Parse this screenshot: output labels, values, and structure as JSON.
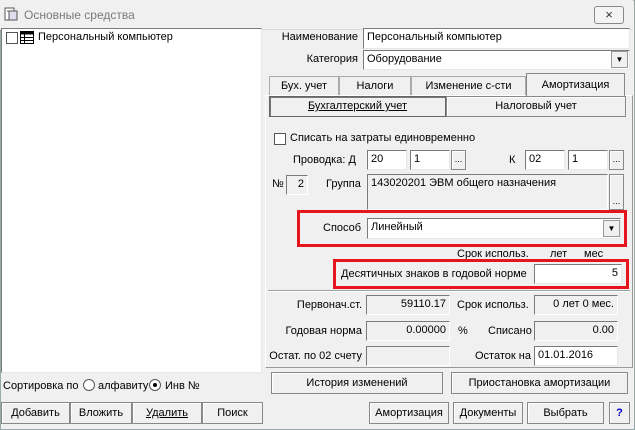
{
  "window": {
    "title": "Основные средства",
    "close_icon": "×"
  },
  "tree": {
    "items": [
      {
        "label": "Персональный компьютер"
      }
    ]
  },
  "sort": {
    "label": "Сортировка по",
    "option1": "алфавиту",
    "option2": "Инв №",
    "selected": "Инв №"
  },
  "left_buttons": {
    "add": "Добавить",
    "insert": "Вложить",
    "delete": "Удалить",
    "search": "Поиск"
  },
  "form": {
    "name_label": "Наименование",
    "name_value": "Персональный компьютер",
    "category_label": "Категория",
    "category_value": "Оборудование"
  },
  "tabs": [
    "Бух. учет",
    "Налоги",
    "Изменение с-сти",
    "Амортизация"
  ],
  "active_tab": "Амортизация",
  "subtabs": [
    "Бухгалтерский учет",
    "Налоговый учет"
  ],
  "amort": {
    "writeoff_label": "Списать на затраты единовременно",
    "posting_label": "Проводка: Д",
    "d_acc": "20",
    "d_sub": "1",
    "k_label": "К",
    "k_acc": "02",
    "k_sub": "1",
    "num_label": "№",
    "num_value": "2",
    "group_label": "Группа",
    "group_value": "143020201 ЭВМ общего назначения",
    "method_label": "Способ",
    "method_value": "Линейный",
    "term_label": "Срок использ.",
    "term_years_unit": "лет",
    "term_months_unit": "мес",
    "decimals_label": "Десятичных знаков в годовой норме",
    "decimals_value": "5"
  },
  "summary": {
    "initial_cost_label": "Первонач.ст.",
    "initial_cost_value": "59110.17",
    "term_label": "Срок использ.",
    "term_value": "0 лет  0 мес.",
    "annual_rate_label": "Годовая норма",
    "annual_rate_value": "0.00000",
    "percent_sign": "%",
    "written_off_label": "Списано",
    "written_off_value": "0.00",
    "residual_02_label": "Остат. по 02 счету",
    "residual_02_value": "",
    "balance_on_label": "Остаток на",
    "balance_on_date": "01.01.2016",
    "balance_value": ""
  },
  "action_buttons": {
    "history": "История изменений",
    "suspend": "Приостановка амортизации"
  },
  "bottom_buttons": {
    "amortization": "Амортизация",
    "documents": "Документы",
    "select": "Выбрать",
    "help": "?"
  }
}
